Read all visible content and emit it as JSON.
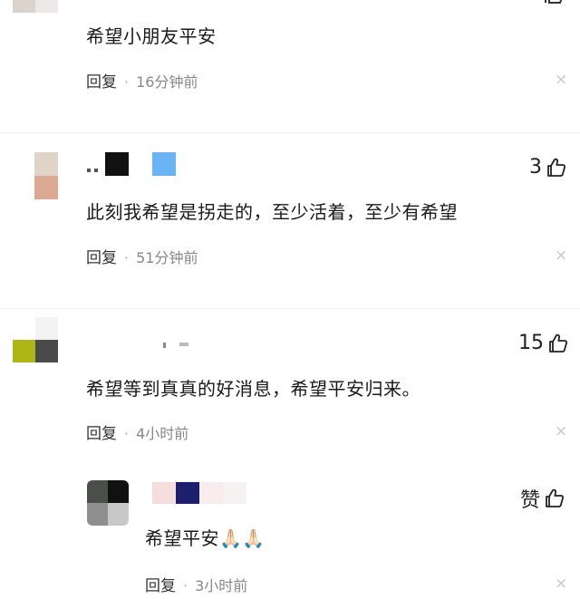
{
  "comments": [
    {
      "text": "希望小朋友平安",
      "reply_label": "回复",
      "separator": "·",
      "time": "16分钟前",
      "close": "×"
    },
    {
      "text": "此刻我希望是拐走的，至少活着，至少有希望",
      "reply_label": "回复",
      "separator": "·",
      "time": "51分钟前",
      "likes": "3",
      "close": "×"
    },
    {
      "text": "希望等到真真的好消息，希望平安归来。",
      "reply_label": "回复",
      "separator": "·",
      "time": "4小时前",
      "likes": "15",
      "close": "×"
    }
  ],
  "reply": {
    "text": "希望平安",
    "emoji": "🙏🏻🙏🏻",
    "reply_label": "回复",
    "separator": "·",
    "time": "3小时前",
    "likes": "赞",
    "close": "×"
  },
  "icons": {
    "like": "thumbs-up-icon",
    "close": "close-icon"
  },
  "colors": {
    "meta": "#888888",
    "text": "#1a1a1a",
    "close": "#c8c8c8"
  }
}
